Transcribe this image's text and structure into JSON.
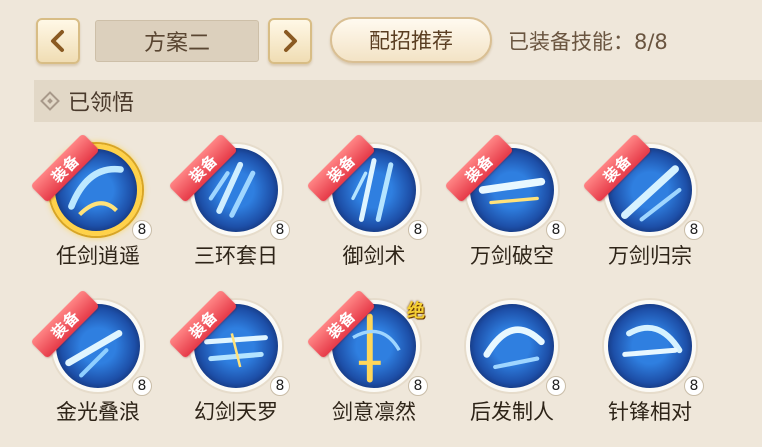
{
  "toolbar": {
    "prev_icon": "chevron-left-icon",
    "next_icon": "chevron-right-icon",
    "plan_name": "方案二",
    "recommend_label": "配招推荐",
    "equipped_label": "已装备技能：8/8"
  },
  "section": {
    "title": "已领悟",
    "icon": "diamond-icon"
  },
  "equip_tag": "装备",
  "jue_tag": "绝",
  "skills": [
    {
      "name": "任剑逍遥",
      "level": "8",
      "equipped": true,
      "gold_ring": true
    },
    {
      "name": "三环套日",
      "level": "8",
      "equipped": true
    },
    {
      "name": "御剑术",
      "level": "8",
      "equipped": true
    },
    {
      "name": "万剑破空",
      "level": "8",
      "equipped": true
    },
    {
      "name": "万剑归宗",
      "level": "8",
      "equipped": true
    },
    {
      "name": "金光叠浪",
      "level": "8",
      "equipped": true
    },
    {
      "name": "幻剑天罗",
      "level": "8",
      "equipped": true
    },
    {
      "name": "剑意凛然",
      "level": "8",
      "equipped": true,
      "ultimate": true
    },
    {
      "name": "后发制人",
      "level": "8",
      "equipped": false
    },
    {
      "name": "针锋相对",
      "level": "8",
      "equipped": false
    }
  ],
  "colors": {
    "background": "#efe7da",
    "equip_ribbon": "#e63a48",
    "gold_ring": "#ffd24a",
    "skill_blue": "#2f7fe0"
  }
}
